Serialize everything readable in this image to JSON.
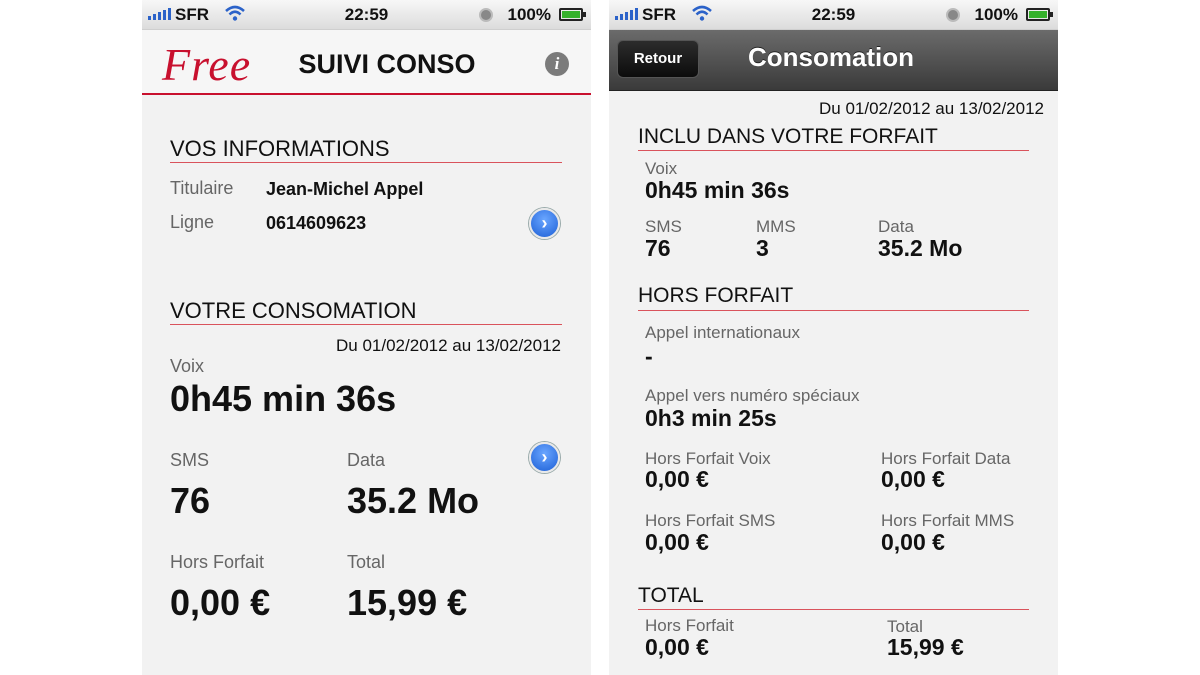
{
  "status_bar": {
    "carrier": "SFR",
    "time": "22:59",
    "battery": "100%"
  },
  "left": {
    "logo_text": "Free",
    "title": "SUIVI CONSO",
    "info_icon_glyph": "i",
    "vos_informations": {
      "title": "VOS INFORMATIONS",
      "titulaire_label": "Titulaire",
      "titulaire_value": "Jean-Michel Appel",
      "ligne_label": "Ligne",
      "ligne_value": "0614609623"
    },
    "consommation": {
      "title": "VOTRE CONSOMATION",
      "date_range": "Du 01/02/2012 au 13/02/2012",
      "voix_label": "Voix",
      "voix_value": "0h45 min 36s",
      "sms_label": "SMS",
      "sms_value": "76",
      "data_label": "Data",
      "data_value": "35.2 Mo",
      "hors_forfait_label": "Hors Forfait",
      "hors_forfait_value": "0,00 €",
      "total_label": "Total",
      "total_value": "15,99 €"
    }
  },
  "right": {
    "back_label": "Retour",
    "nav_title": "Consomation",
    "date_range": "Du 01/02/2012 au 13/02/2012",
    "inclu": {
      "title": "INCLU DANS VOTRE FORFAIT",
      "voix_label": "Voix",
      "voix_value": "0h45 min 36s",
      "sms_label": "SMS",
      "sms_value": "76",
      "mms_label": "MMS",
      "mms_value": "3",
      "data_label": "Data",
      "data_value": "35.2 Mo"
    },
    "hors_forfait": {
      "title": "HORS FORFAIT",
      "intl_label": "Appel internationaux",
      "intl_value": "-",
      "speciaux_label": "Appel vers numéro spéciaux",
      "speciaux_value": "0h3 min 25s",
      "hf_voix_label": "Hors Forfait Voix",
      "hf_voix_value": "0,00 €",
      "hf_data_label": "Hors Forfait Data",
      "hf_data_value": "0,00 €",
      "hf_sms_label": "Hors Forfait SMS",
      "hf_sms_value": "0,00 €",
      "hf_mms_label": "Hors Forfait MMS",
      "hf_mms_value": "0,00 €"
    },
    "total": {
      "title": "TOTAL",
      "hors_forfait_label": "Hors Forfait",
      "hors_forfait_value": "0,00 €",
      "total_label": "Total",
      "total_value": "15,99 €"
    }
  },
  "colors": {
    "brand_red": "#c8102e",
    "accent_blue": "#1c5fd6"
  },
  "icons": [
    "signal-icon",
    "wifi-icon",
    "lock-icon",
    "battery-icon",
    "info-icon",
    "chevron-right-icon"
  ]
}
